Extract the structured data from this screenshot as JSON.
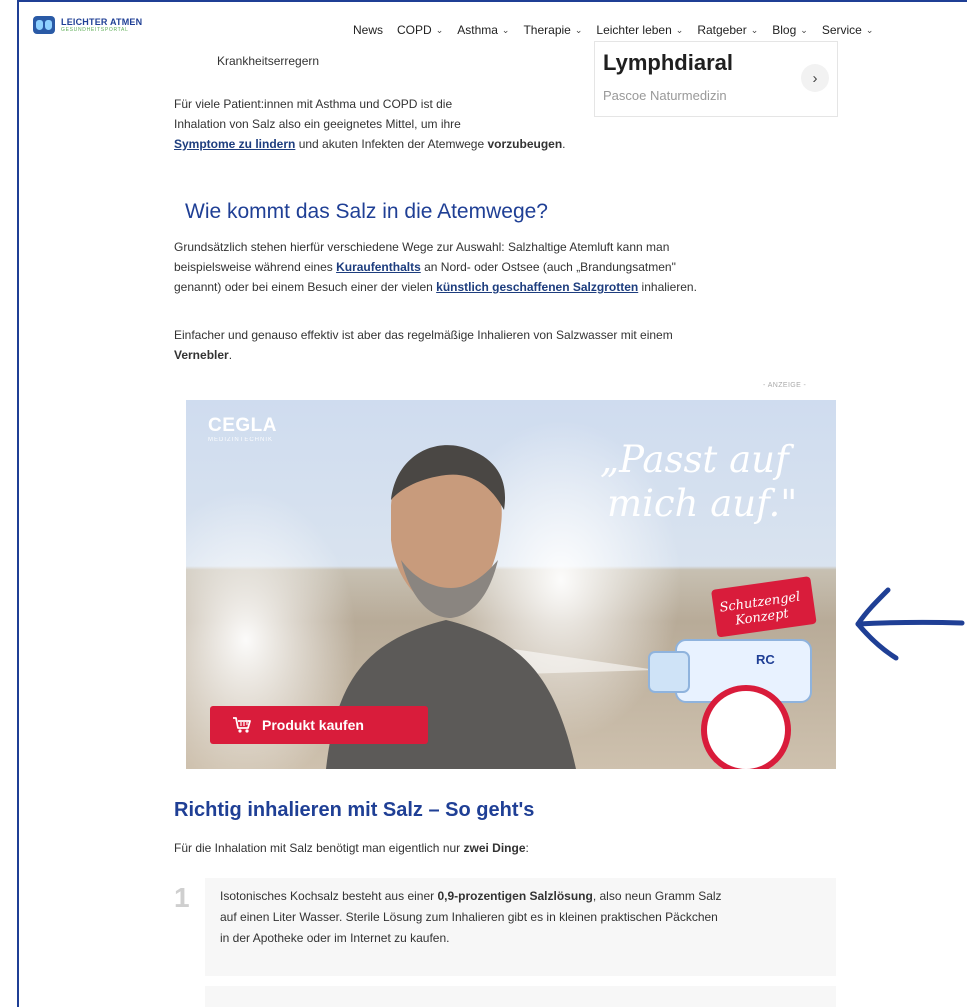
{
  "brand": {
    "name": "LEICHTER ATMEN",
    "sub": "GESUNDHEITSPORTAL"
  },
  "nav": [
    {
      "label": "News",
      "has_chevron": false
    },
    {
      "label": "COPD",
      "has_chevron": true
    },
    {
      "label": "Asthma",
      "has_chevron": true
    },
    {
      "label": "Therapie",
      "has_chevron": true
    },
    {
      "label": "Leichter leben",
      "has_chevron": true
    },
    {
      "label": "Ratgeber",
      "has_chevron": true
    },
    {
      "label": "Blog",
      "has_chevron": true
    },
    {
      "label": "Service",
      "has_chevron": true
    }
  ],
  "ad_box": {
    "title": "Lymphdiaral",
    "subtitle": "Pascoe Naturmedizin"
  },
  "intro": {
    "prev_line": "Krankheitserregern",
    "p1_a": "Für viele Patient:innen mit Asthma und COPD ist die",
    "p1_b": "Inhalation von Salz also ein geeignetes Mittel, um ihre",
    "p1_link": "Symptome zu lindern",
    "p1_c": " und akuten Infekten der Atemwege ",
    "p1_strong": "vorzubeugen",
    "p1_end": "."
  },
  "section1": {
    "heading": "Wie kommt das Salz in die Atemwege?",
    "p_a": "Grundsätzlich stehen hierfür verschiedene Wege zur Auswahl: Salzhaltige Atemluft kann man",
    "p_b": "beispielsweise während eines ",
    "p_link1": "Kuraufenthalts",
    "p_c": " an Nord- oder Ostsee (auch „Brandungsatmen\"",
    "p_d": "genannt) oder bei einem Besuch einer der vielen ",
    "p_link2": "künstlich geschaffenen Salzgrotten",
    "p_e": " inhalieren.",
    "p2_a": "Einfacher und genauso effektiv ist aber das regelmäßige Inhalieren von Salzwasser mit einem",
    "p2_strong": "Vernebler",
    "p2_end": "."
  },
  "ad_label": "- ANZEIGE -",
  "banner": {
    "brand": "CEGLA",
    "brand_sub": "MEDIZINTECHNIK",
    "quote_1": "„Passt auf",
    "quote_2": "mich auf.\"",
    "badge_1": "Schutzengel",
    "badge_2": "Konzept",
    "device_label": "RC",
    "cta": "Produkt kaufen"
  },
  "section2": {
    "heading": "Richtig inhalieren mit Salz – So geht's",
    "p_a": "Für die Inhalation mit Salz benötigt man eigentlich nur ",
    "p_strong": "zwei Dinge",
    "p_end": ":"
  },
  "steps": [
    {
      "num": "1",
      "a": "Isotonisches Kochsalz besteht aus einer ",
      "strong": "0,9-prozentigen Salzlösung",
      "b": ", also neun Gramm Salz",
      "c": "auf einen Liter Wasser. Sterile Lösung zum Inhalieren gibt es in kleinen praktischen Päckchen",
      "d": "in der Apotheke oder im Internet zu kaufen."
    }
  ],
  "colors": {
    "frame_blue": "#1f3f95",
    "heading_blue": "#1f3f95",
    "link_blue": "#1d3d7e",
    "cta_red": "#d91c3b",
    "arrow_blue": "#1f3f95"
  },
  "icons": {
    "cart": "shopping-cart-icon",
    "arrow": "left-arrow-annotation",
    "chevron": "chevron-down-icon"
  }
}
